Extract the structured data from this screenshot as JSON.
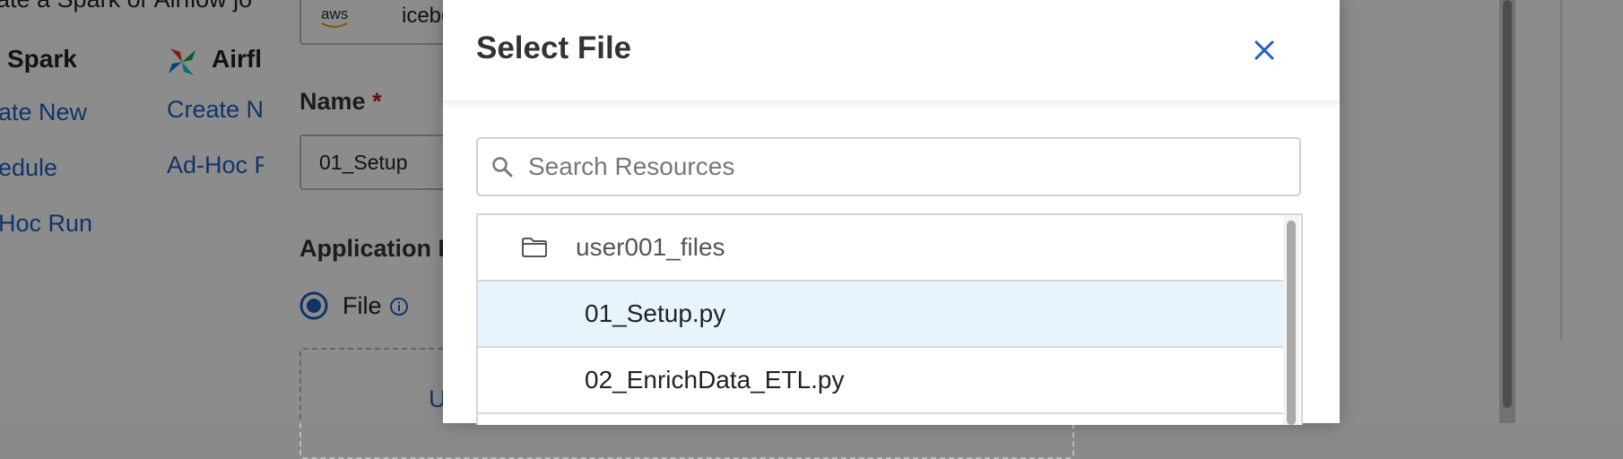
{
  "background": {
    "top_text": "ate a Spark or Airflow jo",
    "spark_label": "Spark",
    "airflow_label": "Airfl",
    "spark_links": [
      "ate New",
      "edule",
      "Hoc Run"
    ],
    "airflow_links": [
      "Create N",
      "Ad-Hoc R"
    ],
    "storage_value": "iceberg-",
    "storage_icon_text": "aws",
    "name_label": "Name",
    "name_required": "*",
    "name_value": "01_Setup",
    "application_label": "Application F",
    "file_radio_label": "File",
    "upload_text": "U"
  },
  "modal": {
    "title": "Select File",
    "search_placeholder": "Search Resources",
    "search_value": "",
    "tree": [
      {
        "label": "user001_files",
        "type": "folder",
        "selected": false
      },
      {
        "label": "01_Setup.py",
        "type": "file",
        "selected": true
      },
      {
        "label": "02_EnrichData_ETL.py",
        "type": "file",
        "selected": false
      }
    ]
  },
  "colors": {
    "link": "#1f5fbf",
    "selected_row": "#e8f4fc",
    "close_icon": "#1f5fbf",
    "required": "#b02020"
  }
}
